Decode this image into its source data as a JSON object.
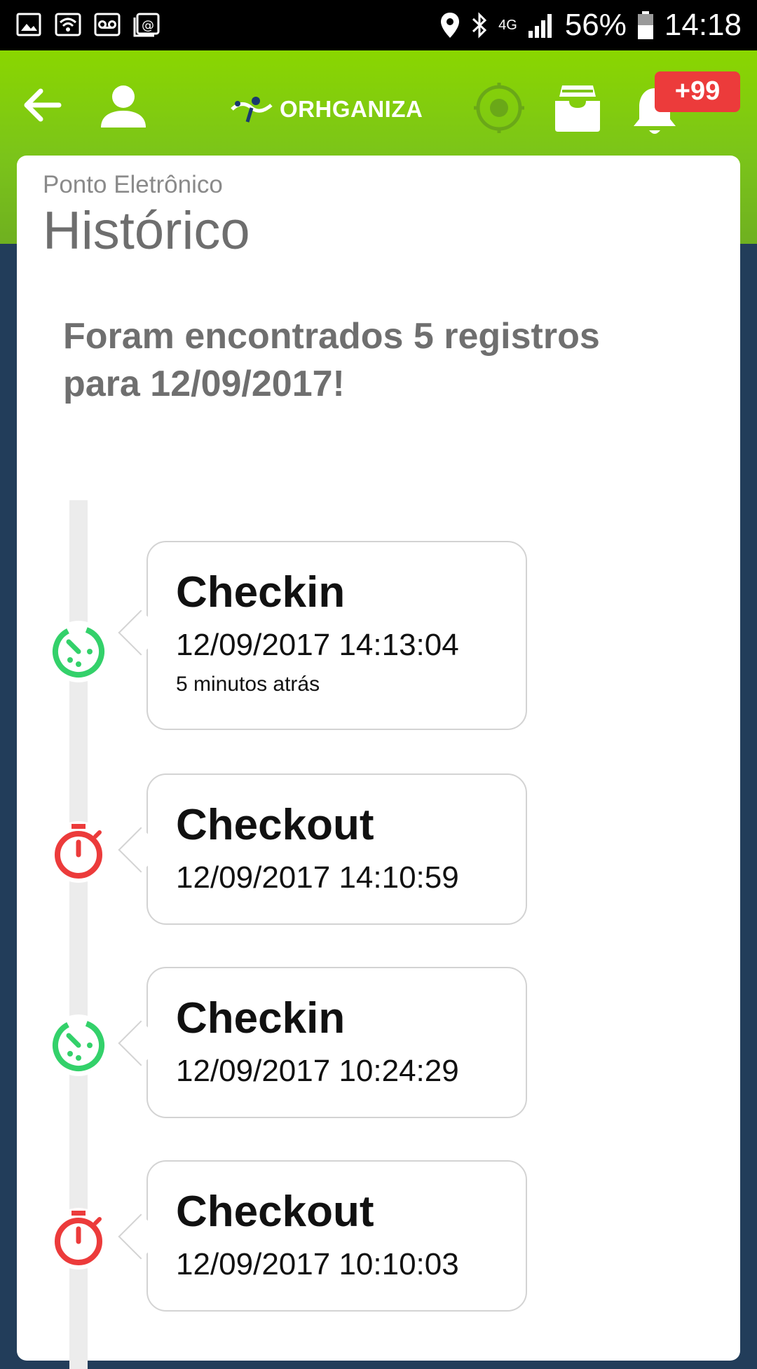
{
  "status_bar": {
    "network": "4G",
    "battery": "56%",
    "time": "14:18",
    "icons": [
      "gallery-icon",
      "wifi-icon",
      "voicemail-icon",
      "email-icon",
      "location-icon",
      "bluetooth-icon",
      "signal-icon",
      "battery-icon"
    ]
  },
  "app_bar": {
    "logo_text": "ORHGANIZA",
    "notification_count": "+99",
    "accent_color": "#7ed000"
  },
  "page": {
    "subtitle": "Ponto Eletrônico",
    "title": "Histórico",
    "summary": "Foram encontrados 5 registros para 12/09/2017!"
  },
  "entries": [
    {
      "type": "Checkin",
      "datetime": "12/09/2017 14:13:04",
      "relative": "5 minutos atrás",
      "status_color": "#33d16a"
    },
    {
      "type": "Checkout",
      "datetime": "12/09/2017 14:10:59",
      "status_color": "#ec3b3b"
    },
    {
      "type": "Checkin",
      "datetime": "12/09/2017 10:24:29",
      "status_color": "#33d16a"
    },
    {
      "type": "Checkout",
      "datetime": "12/09/2017 10:10:03",
      "status_color": "#ec3b3b"
    }
  ]
}
